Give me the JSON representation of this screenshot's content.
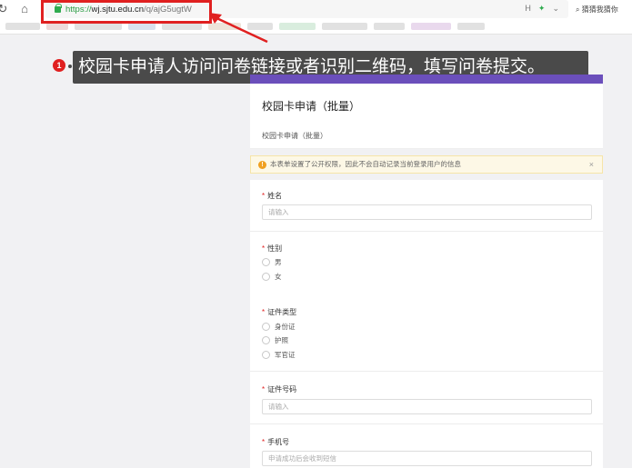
{
  "browser": {
    "url_scheme": "https://",
    "url_host": "wj.sjtu.edu.cn",
    "url_path": "/q/ajG5ugtW",
    "right_icons": [
      "H",
      "✦",
      "⌄"
    ],
    "search_text": "猜猜我猜你",
    "icons": {
      "refresh": "refresh-icon",
      "home": "home-icon",
      "lock": "lock-icon",
      "search": "search-icon"
    }
  },
  "annotation": {
    "badge": "1",
    "text": "校园卡申请人访问问卷链接或者识别二维码，填写问卷提交。",
    "color": "#e02020"
  },
  "form": {
    "accent": "#6b4fbb",
    "title": "校园卡申请（批量）",
    "subtitle": "校园卡申请（批量）",
    "notice": "本表单设置了公开权限，因此不会自动记录当前登录用户的信息",
    "notice_close": "×",
    "fields": {
      "name": {
        "label": "姓名",
        "placeholder": "请输入"
      },
      "gender": {
        "label": "性别",
        "options": [
          "男",
          "女"
        ]
      },
      "id_type": {
        "label": "证件类型",
        "options": [
          "身份证",
          "护照",
          "军官证"
        ]
      },
      "id_number": {
        "label": "证件号码",
        "placeholder": "请输入"
      },
      "phone": {
        "label": "手机号",
        "placeholder": "申请成功后会收到短信"
      }
    },
    "required_mark": "*"
  }
}
